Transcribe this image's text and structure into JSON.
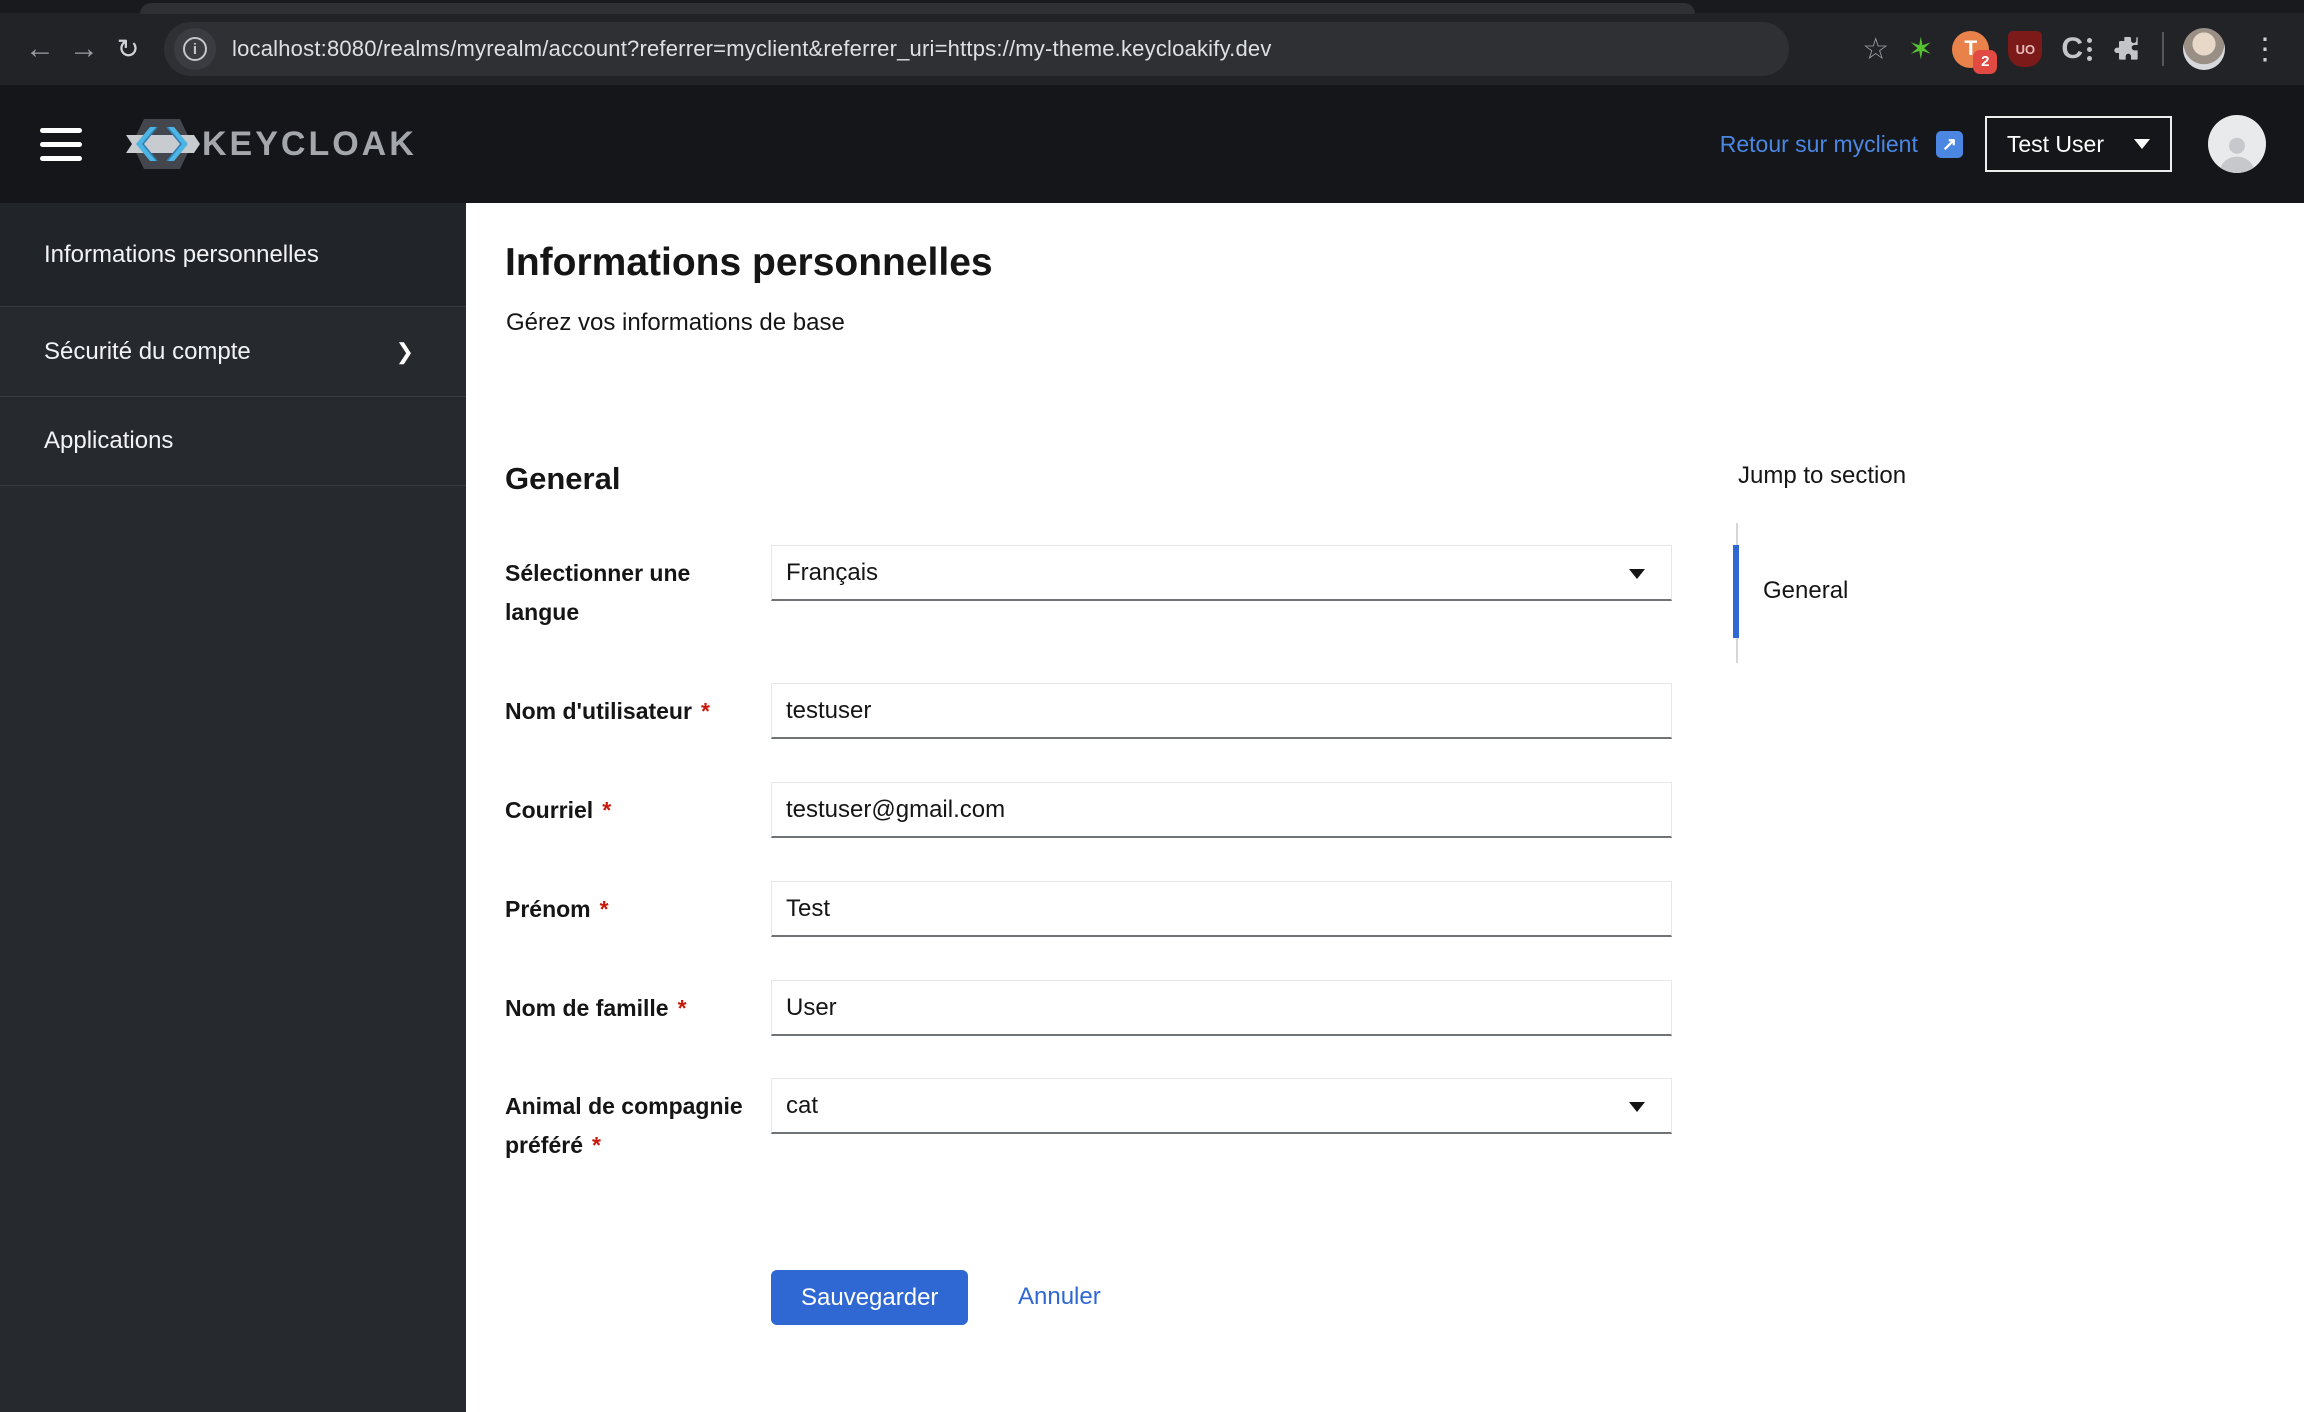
{
  "browser": {
    "url": "localhost:8080/realms/myrealm/account?referrer=myclient&referrer_uri=https://my-theme.keycloakify.dev",
    "icons": {
      "back": "←",
      "forward": "→",
      "reload": "↻",
      "info": "i",
      "bookmark_star": "☆",
      "menu_kebab": "⋮",
      "green_star_ext": "✶"
    },
    "extensions": {
      "t_label": "T",
      "t_badge": "2",
      "ublock_label": "UO",
      "c_label": "C"
    }
  },
  "app_icons": {
    "chevron_right": "❯",
    "external_link": "↗"
  },
  "header": {
    "brand": "KEYCLOAK",
    "referrer_link_label": "Retour sur myclient",
    "user_menu_label": "Test User"
  },
  "sidebar": {
    "items": [
      {
        "label": "Informations personnelles",
        "name": "personal-info",
        "current": true,
        "expandable": false
      },
      {
        "label": "Sécurité du compte",
        "name": "account-security",
        "current": false,
        "expandable": true
      },
      {
        "label": "Applications",
        "name": "applications",
        "current": false,
        "expandable": false
      }
    ]
  },
  "main": {
    "title": "Informations personnelles",
    "subtitle": "Gérez vos informations de base",
    "section_heading": "General",
    "jump": {
      "title": "Jump to section",
      "items": [
        {
          "label": "General",
          "current": true
        }
      ]
    },
    "form": {
      "required_marker": "*",
      "fields": [
        {
          "label": "Sélectionner une langue",
          "name": "language-select",
          "type": "select",
          "required": false,
          "value": "Français"
        },
        {
          "label": "Nom d'utilisateur",
          "name": "username-input",
          "type": "text",
          "required": true,
          "value": "testuser"
        },
        {
          "label": "Courriel",
          "name": "email-input",
          "type": "text",
          "required": true,
          "value": "testuser@gmail.com"
        },
        {
          "label": "Prénom",
          "name": "first-name-input",
          "type": "text",
          "required": true,
          "value": "Test"
        },
        {
          "label": "Nom de famille",
          "name": "last-name-input",
          "type": "text",
          "required": true,
          "value": "User"
        },
        {
          "label": "Animal de compagnie préféré",
          "name": "favorite-pet-select",
          "type": "select",
          "required": true,
          "value": "cat"
        }
      ],
      "save_label": "Sauvegarder",
      "cancel_label": "Annuler"
    }
  },
  "colors": {
    "accent_blue": "#2f68d3",
    "header_link_blue": "#4b87e2",
    "required_red": "#c9190b"
  }
}
